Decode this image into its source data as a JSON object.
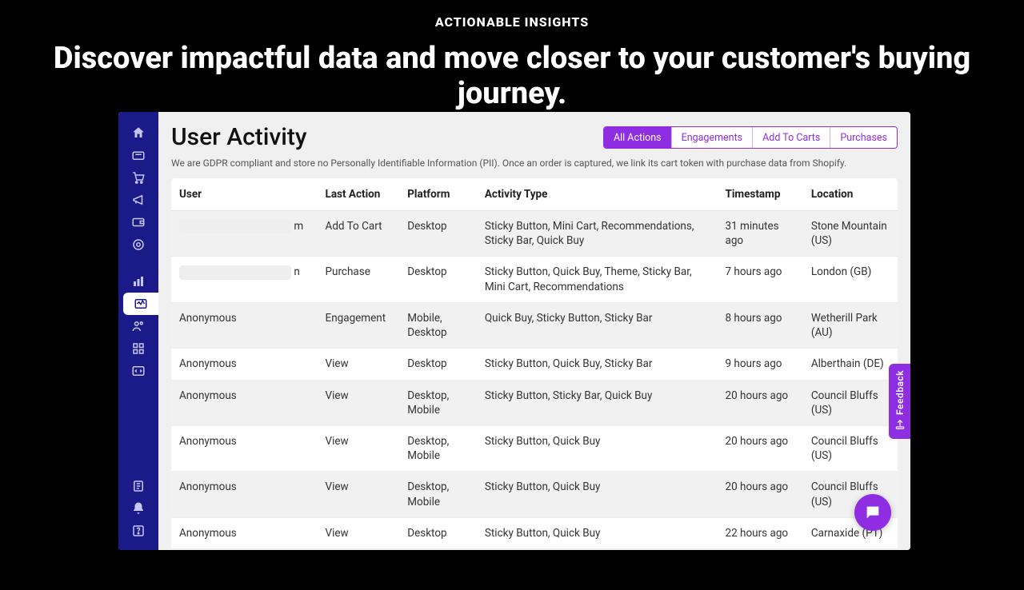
{
  "hero": {
    "eyebrow": "ACTIONABLE INSIGHTS",
    "headline": "Discover impactful data and move closer to your customer's buying journey."
  },
  "page": {
    "title": "User Activity",
    "gdpr_note": "We are GDPR compliant and store no Personally Identifiable Information (PII). Once an order is captured, we link its cart token with purchase data from Shopify."
  },
  "filters": {
    "all": "All Actions",
    "engagements": "Engagements",
    "addtocarts": "Add To Carts",
    "purchases": "Purchases"
  },
  "columns": {
    "user": "User",
    "last_action": "Last Action",
    "platform": "Platform",
    "activity_type": "Activity Type",
    "timestamp": "Timestamp",
    "location": "Location"
  },
  "rows": [
    {
      "user": "m",
      "user_blurred": true,
      "last_action": "Add To Cart",
      "platform": "Desktop",
      "activity_type": "Sticky Button, Mini Cart, Recommendations, Sticky Bar, Quick Buy",
      "timestamp": "31 minutes ago",
      "location": "Stone Mountain (US)"
    },
    {
      "user": "n",
      "user_blurred": true,
      "last_action": "Purchase",
      "platform": "Desktop",
      "activity_type": "Sticky Button, Quick Buy, Theme, Sticky Bar, Mini Cart, Recommendations",
      "timestamp": "7 hours ago",
      "location": "London (GB)"
    },
    {
      "user": "Anonymous",
      "user_blurred": false,
      "last_action": "Engagement",
      "platform": "Mobile, Desktop",
      "activity_type": "Quick Buy, Sticky Button, Sticky Bar",
      "timestamp": "8 hours ago",
      "location": "Wetherill Park (AU)"
    },
    {
      "user": "Anonymous",
      "user_blurred": false,
      "last_action": "View",
      "platform": "Desktop",
      "activity_type": "Sticky Button, Quick Buy, Sticky Bar",
      "timestamp": "9 hours ago",
      "location": "Alberthain (DE)"
    },
    {
      "user": "Anonymous",
      "user_blurred": false,
      "last_action": "View",
      "platform": "Desktop, Mobile",
      "activity_type": "Sticky Button, Sticky Bar, Quick Buy",
      "timestamp": "20 hours ago",
      "location": "Council Bluffs (US)"
    },
    {
      "user": "Anonymous",
      "user_blurred": false,
      "last_action": "View",
      "platform": "Desktop, Mobile",
      "activity_type": "Sticky Button, Quick Buy",
      "timestamp": "20 hours ago",
      "location": "Council Bluffs (US)"
    },
    {
      "user": "Anonymous",
      "user_blurred": false,
      "last_action": "View",
      "platform": "Desktop, Mobile",
      "activity_type": "Sticky Button, Quick Buy",
      "timestamp": "20 hours ago",
      "location": "Council Bluffs (US)"
    },
    {
      "user": "Anonymous",
      "user_blurred": false,
      "last_action": "View",
      "platform": "Desktop",
      "activity_type": "Sticky Button, Quick Buy",
      "timestamp": "22 hours ago",
      "location": "Carnaxide (PT)"
    }
  ],
  "feedback": {
    "label": "Feedback"
  }
}
